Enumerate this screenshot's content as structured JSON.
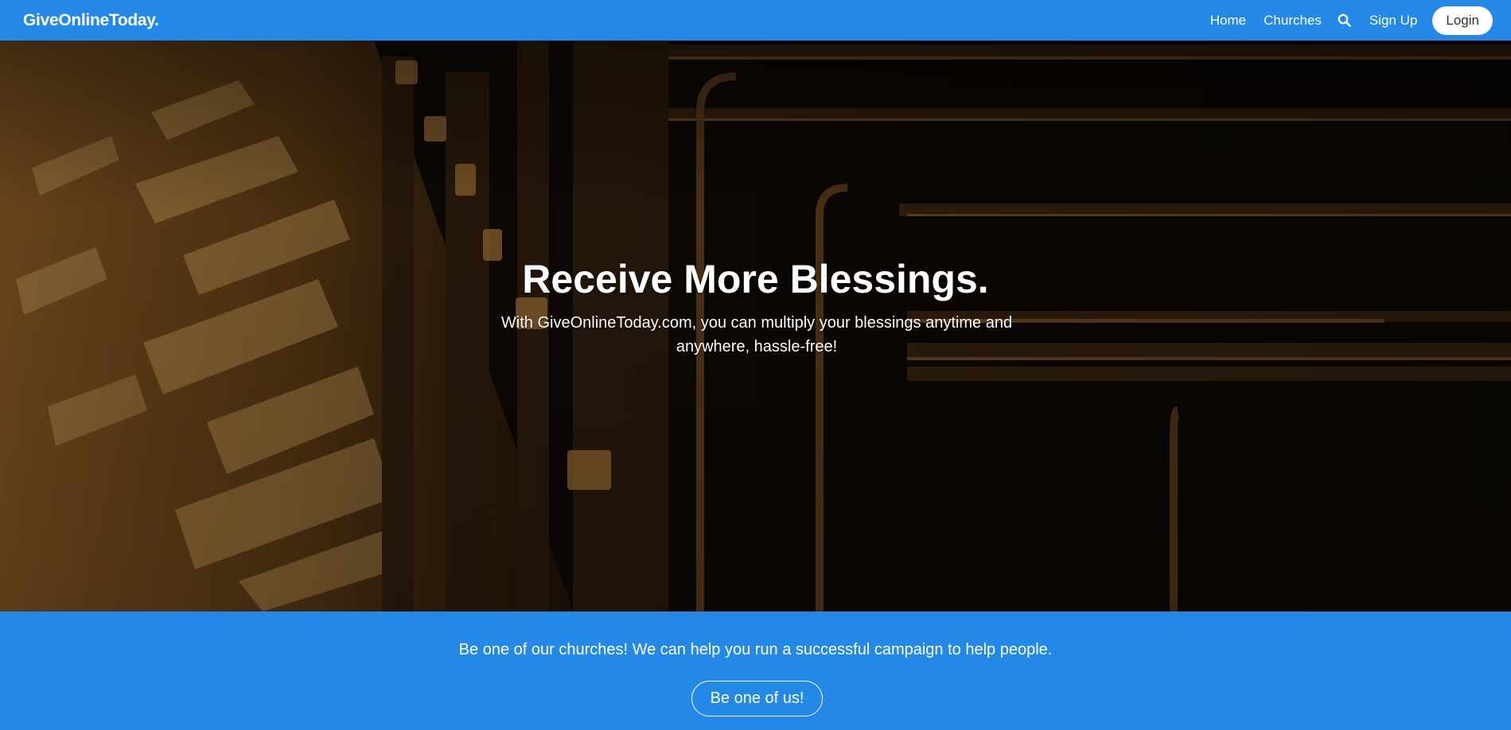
{
  "navbar": {
    "brand": "GiveOnlineToday.",
    "links": {
      "home": "Home",
      "churches": "Churches",
      "sign_up": "Sign Up"
    },
    "search_icon": "search-icon",
    "login_label": "Login",
    "background_color": "#2388e6"
  },
  "hero": {
    "title": "Receive More Blessings.",
    "subtitle": "With GiveOnlineToday.com, you can multiply your blessings anytime and anywhere, hassle-free!"
  },
  "cta": {
    "text": "Be one of our churches! We can help you run a successful campaign to help people.",
    "button_label": "Be one of us!"
  }
}
